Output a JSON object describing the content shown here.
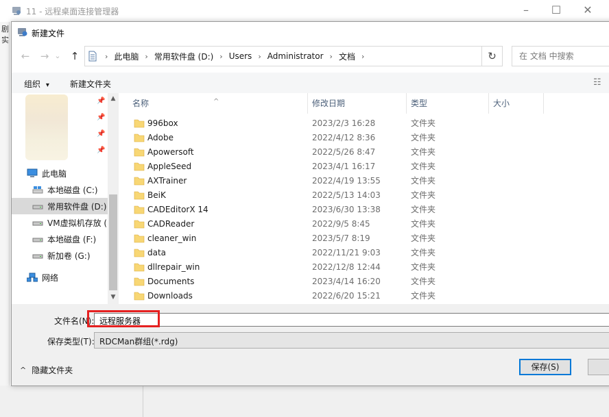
{
  "parent_window": {
    "title": "11 - 远程桌面连接管理器",
    "minimize": "–",
    "maximize": "☐",
    "close": "✕",
    "left_strip_chars": [
      "剧",
      "实"
    ]
  },
  "dialog": {
    "title": "新建文件",
    "nav": {
      "back": "←",
      "forward": "→",
      "dropdown": "⌄",
      "up": "↑",
      "refresh": "↻"
    },
    "breadcrumb": [
      "此电脑",
      "常用软件盘 (D:)",
      "Users",
      "Administrator",
      "文档"
    ],
    "search_placeholder": "在 文档 中搜索",
    "toolbar": {
      "organize": "组织",
      "organize_caret": "▾",
      "new_folder": "新建文件夹",
      "view_icon": "☷"
    },
    "sidebar": {
      "this_pc": "此电脑",
      "drives": [
        {
          "label": "本地磁盘 (C:)",
          "state": "normal"
        },
        {
          "label": "常用软件盘 (D:)",
          "state": "selected"
        },
        {
          "label": "VM虚拟机存放 (",
          "state": "normal"
        },
        {
          "label": "本地磁盘 (F:)",
          "state": "normal"
        },
        {
          "label": "新加卷 (G:)",
          "state": "normal"
        }
      ],
      "network": "网络",
      "pin_icon": "📌",
      "scroll_up": "▲",
      "scroll_down": "▼"
    },
    "columns": {
      "name": "名称",
      "date": "修改日期",
      "type": "类型",
      "size": "大小",
      "sort_caret": "^"
    },
    "files": [
      {
        "name": "996box",
        "date": "2023/2/3 16:28",
        "type": "文件夹"
      },
      {
        "name": "Adobe",
        "date": "2022/4/12 8:36",
        "type": "文件夹"
      },
      {
        "name": "Apowersoft",
        "date": "2022/5/26 8:47",
        "type": "文件夹"
      },
      {
        "name": "AppleSeed",
        "date": "2023/4/1 16:17",
        "type": "文件夹"
      },
      {
        "name": "AXTrainer",
        "date": "2022/4/19 13:55",
        "type": "文件夹"
      },
      {
        "name": "BeiK",
        "date": "2022/5/13 14:03",
        "type": "文件夹"
      },
      {
        "name": "CADEditorX 14",
        "date": "2023/6/30 13:38",
        "type": "文件夹"
      },
      {
        "name": "CADReader",
        "date": "2022/9/5 8:45",
        "type": "文件夹"
      },
      {
        "name": "cleaner_win",
        "date": "2023/5/7 8:19",
        "type": "文件夹"
      },
      {
        "name": "data",
        "date": "2022/11/21 9:03",
        "type": "文件夹"
      },
      {
        "name": "dllrepair_win",
        "date": "2022/12/8 12:44",
        "type": "文件夹"
      },
      {
        "name": "Documents",
        "date": "2023/4/14 16:20",
        "type": "文件夹"
      },
      {
        "name": "Downloads",
        "date": "2022/6/20 15:21",
        "type": "文件夹"
      }
    ],
    "form": {
      "filename_label": "文件名(N):",
      "filename_value": "远程服务器",
      "filetype_label": "保存类型(T):",
      "filetype_value": "RDCMan群组(*.rdg)",
      "hide_folders": "隐藏文件夹",
      "hide_caret": "^",
      "save_button": "保存(S)"
    },
    "colors": {
      "selected_bg": "#cce8ff",
      "highlight_red": "#e52020",
      "primary_border": "#0078d7",
      "folder_yellow": "#f8d775"
    }
  }
}
